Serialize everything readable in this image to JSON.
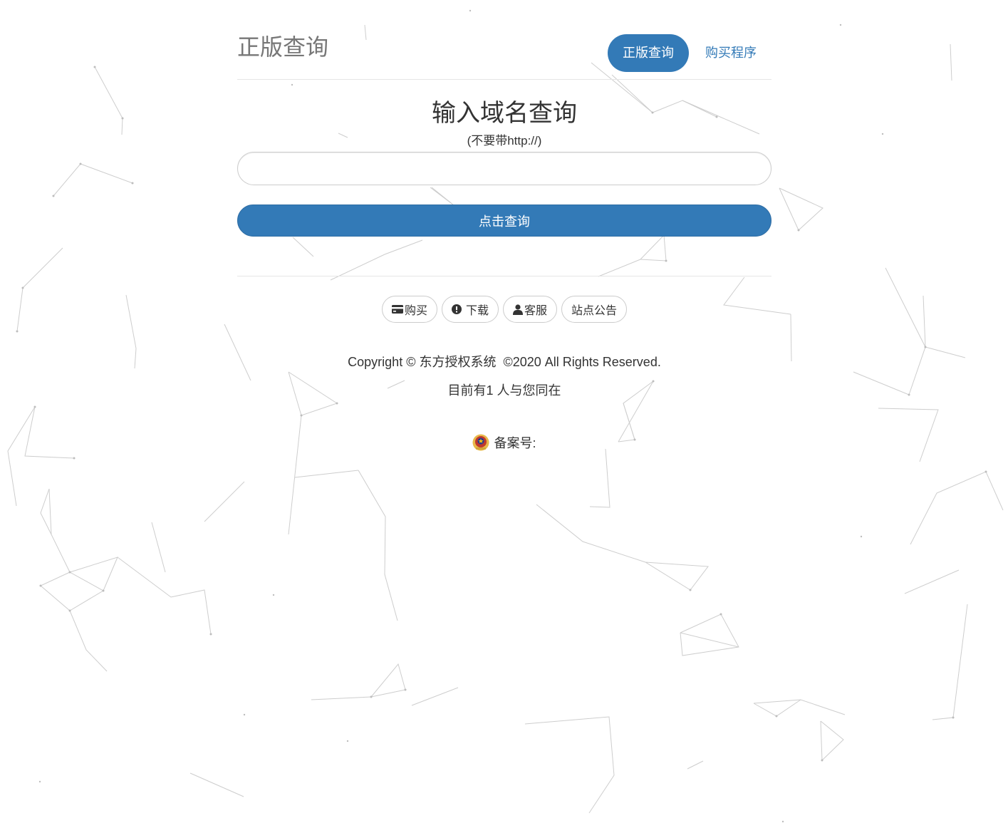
{
  "header": {
    "brand": "正版查询",
    "nav": [
      {
        "label": "正版查询",
        "active": true
      },
      {
        "label": "购买程序",
        "active": false
      }
    ]
  },
  "query": {
    "title": "输入域名查询",
    "hint": "(不要带http://)",
    "input_value": "",
    "input_placeholder": "",
    "submit_label": "点击查询"
  },
  "footer": {
    "buttons": [
      {
        "label": "购买",
        "icon": "credit-card-icon"
      },
      {
        "label": "下载",
        "icon": "exclamation-circle-icon"
      },
      {
        "label": "客服",
        "icon": "user-icon"
      },
      {
        "label": "站点公告",
        "icon": ""
      }
    ],
    "copyright": "Copyright © 东方授权系统  ©2020 All Rights Reserved.",
    "online": "目前有1 人与您同在",
    "beian": "备案号:"
  },
  "colors": {
    "primary": "#337ab7",
    "brand_text": "#777777",
    "background_lines": "#d0d0d0"
  }
}
